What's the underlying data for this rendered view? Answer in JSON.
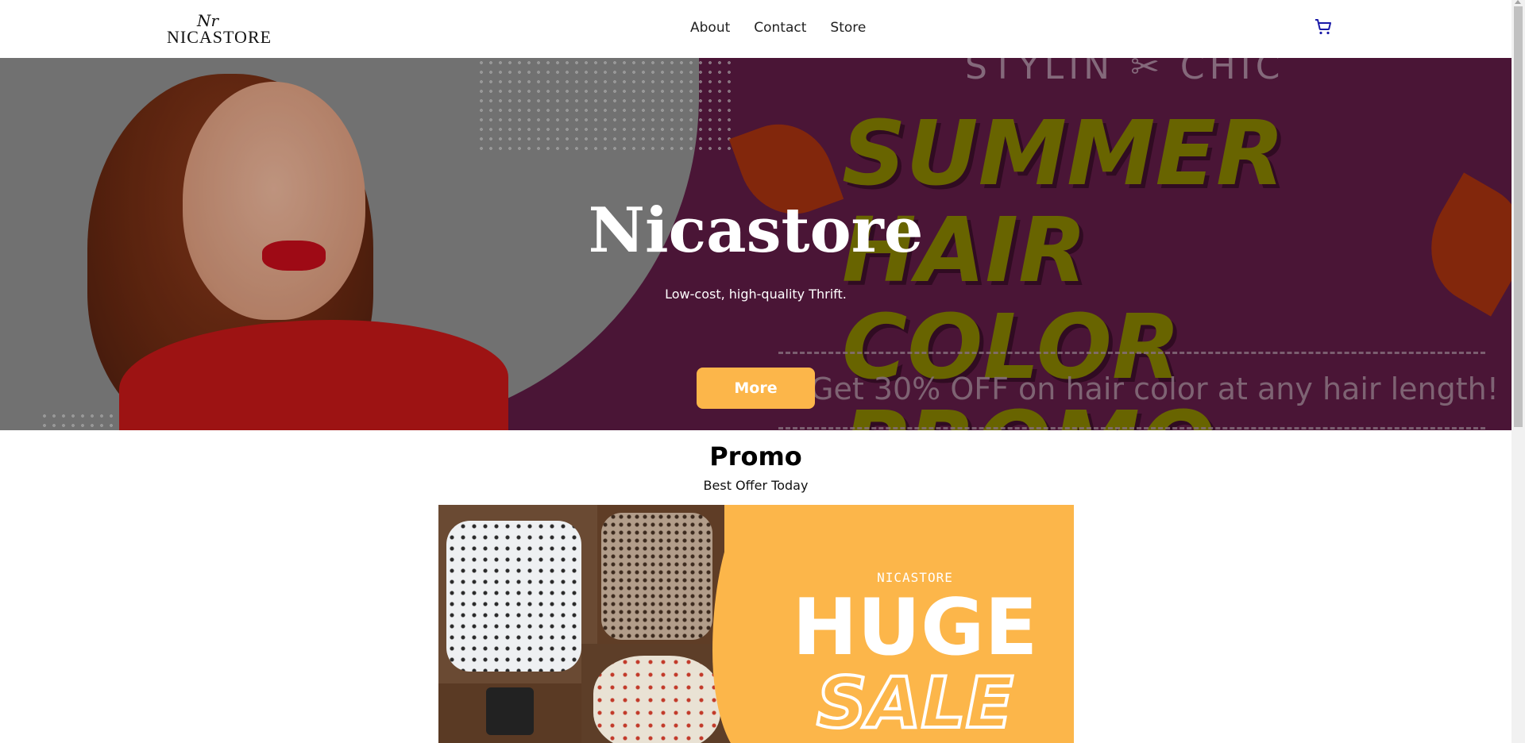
{
  "navbar": {
    "logo_mark": "Nr",
    "logo_text": "NICASTORE",
    "links": [
      {
        "label": "About"
      },
      {
        "label": "Contact"
      },
      {
        "label": "Store"
      }
    ],
    "cart_icon": "shopping-cart-icon",
    "cart_color": "#1a1aa8"
  },
  "hero": {
    "background_promo": {
      "top_text": "STYLIN ✂ CHIC",
      "headline_line1": "SUMMER HAIR",
      "headline_line2": "COLOR PROMO",
      "offer_text": "Get 30% OFF  on hair color at any hair length!"
    },
    "title": "Nicastore",
    "subtitle": "Low-cost, high-quality Thrift.",
    "button_label": "More"
  },
  "promo": {
    "title": "Promo",
    "subtitle": "Best Offer Today",
    "banner": {
      "brand": "NICASTORE",
      "headline": "HUGE",
      "subheadline": "SALE"
    }
  },
  "colors": {
    "accent": "#fcb64a",
    "hero_bg": "#5b1a42",
    "promo_text": "#7f7a00"
  }
}
